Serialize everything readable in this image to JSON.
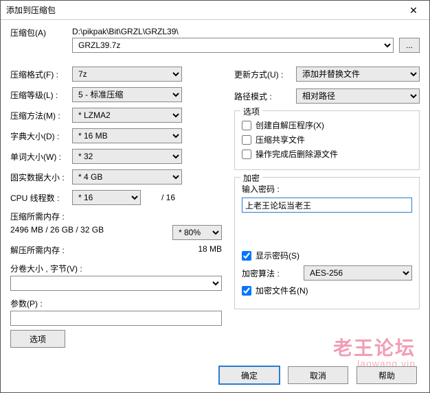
{
  "title": "添加到压缩包",
  "close_glyph": "✕",
  "labels": {
    "archive": "压缩包(A)",
    "format": "压缩格式(F) :",
    "level": "压缩等级(L) :",
    "method": "压缩方法(M) :",
    "dict": "字典大小(D) :",
    "word": "单词大小(W) :",
    "solid": "固实数据大小 :",
    "cpu": "CPU 线程数 :",
    "mem_compress_lbl": "压缩所需内存 :",
    "mem_decompress_lbl": "解压所需内存 :",
    "split": "分卷大小 , 字节(V) :",
    "params": "参数(P) :",
    "options_btn": "选项",
    "update": "更新方式(U) :",
    "pathmode": "路径模式 :",
    "opts_legend": "选项",
    "opt_sfx": "创建自解压程序(X)",
    "opt_share": "压缩共享文件",
    "opt_delete": "操作完成后删除源文件",
    "enc_legend": "加密",
    "enc_pw": "输入密码 :",
    "enc_show": "显示密码(S)",
    "enc_algo": "加密算法 :",
    "enc_names": "加密文件名(N)"
  },
  "values": {
    "path": "D:\\pikpak\\Bit\\GRZL\\GRZL39\\",
    "archive_name": "GRZL39.7z",
    "format": "7z",
    "level": "5 - 标准压缩",
    "method": "* LZMA2",
    "dict": "* 16 MB",
    "word": "* 32",
    "solid": "* 4 GB",
    "cpu": "* 16",
    "cpu_suffix": "/ 16",
    "mem_compress": "2496 MB / 26 GB / 32 GB",
    "mem_pct": "* 80%",
    "mem_decompress": "18 MB",
    "update": "添加并替换文件",
    "pathmode": "相对路径",
    "password": "上老王论坛当老王",
    "algo": "AES-256",
    "opt_sfx_checked": false,
    "opt_share_checked": false,
    "opt_delete_checked": false,
    "show_pw_checked": true,
    "enc_names_checked": true
  },
  "buttons": {
    "ok": "确定",
    "cancel": "取消",
    "help": "帮助",
    "browse": "..."
  },
  "watermark": {
    "line1": "老王论坛",
    "line2": "laowang.vip"
  }
}
